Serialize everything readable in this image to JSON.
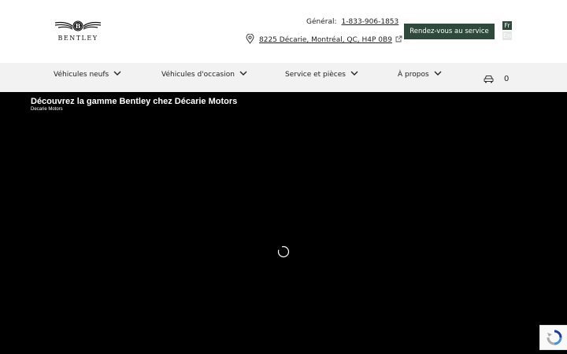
{
  "header": {
    "logo_text": "BENTLEY",
    "phone_label": "Général:",
    "phone_number": "1-833-906-1853",
    "address": "8225 Décarie, Montréal, QC, H4P 0B9",
    "cta_label": "Rendez-vous au service",
    "lang_fr": "Fr",
    "lang_en": "En"
  },
  "nav": {
    "items": [
      {
        "label": "Véhicules neufs"
      },
      {
        "label": "Véhicules d'occasion"
      },
      {
        "label": "Service et pièces"
      },
      {
        "label": "À propos"
      }
    ],
    "cart_count": "0"
  },
  "hero": {
    "title": "Découvrez la gamme Bentley chez Décarie Motors",
    "subtitle": "Decarie Motors"
  },
  "colors": {
    "brand_green": "#2d4a3a",
    "nav_bg": "#f2f2f2",
    "hero_bg": "#000000"
  },
  "icons": [
    "bentley-logo",
    "location-pin-icon",
    "external-link-icon",
    "chevron-down-icon",
    "car-icon",
    "loading-spinner-icon",
    "recaptcha-icon"
  ]
}
